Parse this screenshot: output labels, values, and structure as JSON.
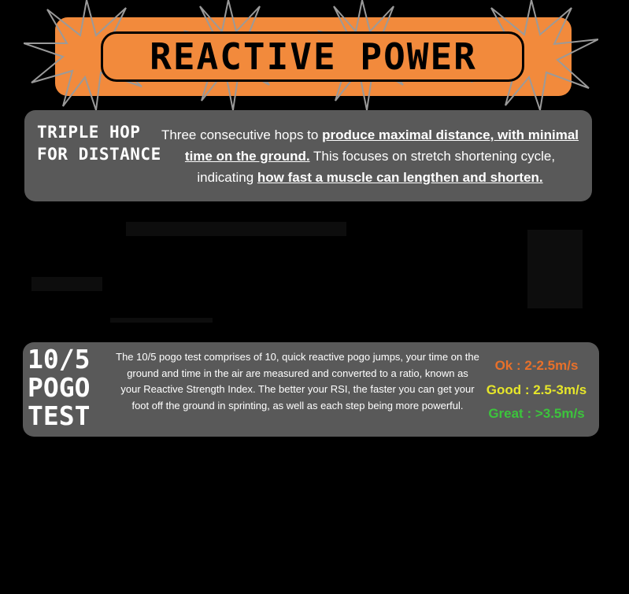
{
  "header": {
    "title": "REACTIVE POWER",
    "colors": {
      "banner": "#f28a3c",
      "burst_stroke": "#9a9a9a"
    }
  },
  "triple_hop": {
    "heading": "TRIPLE HOP FOR DISTANCE",
    "text_1": "Three consecutive hops to ",
    "text_bold_1": "produce maximal distance, with minimal time on the ground.",
    "text_2": " This focuses on stretch shortening cycle, indicating ",
    "text_bold_2": "how fast a muscle can lengthen and shorten."
  },
  "pogo": {
    "heading": "10/5 POGO TEST",
    "description": "The 10/5 pogo test comprises of 10, quick reactive pogo jumps, your time on the ground and time in the air are measured and converted to a ratio, known as your Reactive Strength Index. The better your RSI, the faster you can get your foot off the ground in sprinting, as well as each step being more powerful.",
    "ratings": [
      {
        "label": "Ok : 2-2.5m/s",
        "color": "#e8702a"
      },
      {
        "label": "Good : 2.5-3m/s",
        "color": "#e6e62a"
      },
      {
        "label": "Great : >3.5m/s",
        "color": "#3cc43c"
      }
    ]
  }
}
